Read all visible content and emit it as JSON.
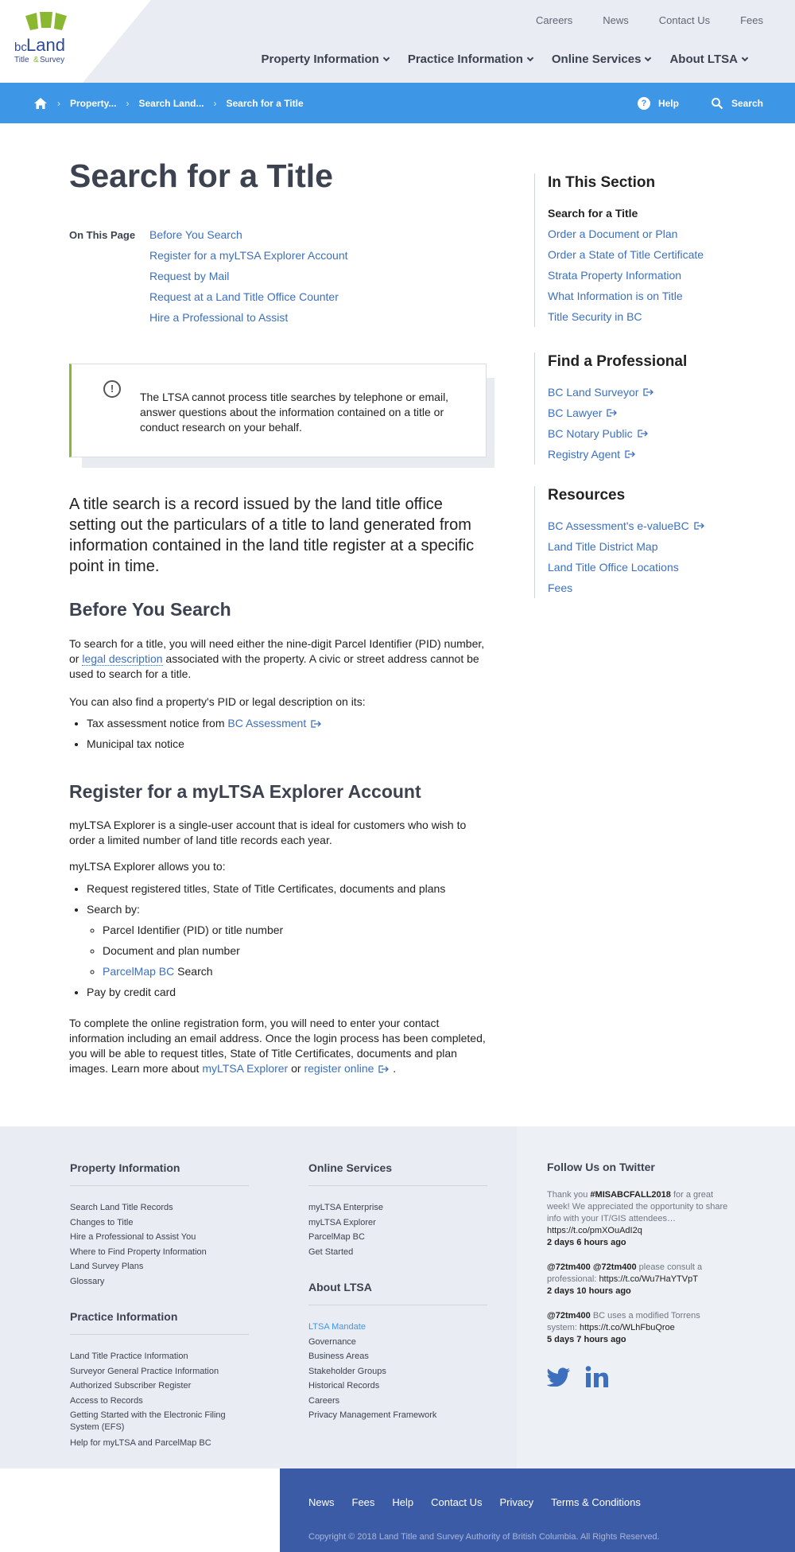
{
  "header": {
    "logo": {
      "bc": "bc",
      "land": "Land",
      "line2_a": "Title",
      "amp": "&",
      "line2_b": "Survey"
    },
    "util_nav": [
      "Careers",
      "News",
      "Contact Us",
      "Fees"
    ],
    "main_nav": [
      "Property Information",
      "Practice Information",
      "Online Services",
      "About LTSA"
    ]
  },
  "breadcrumb": {
    "items": [
      "Property...",
      "Search Land...",
      "Search for a Title"
    ],
    "help_label": "Help",
    "search_label": "Search"
  },
  "main": {
    "title": "Search for a Title",
    "on_this_page_label": "On This Page",
    "on_this_page": [
      "Before You Search",
      "Register for a myLTSA Explorer Account",
      "Request by Mail",
      "Request at a Land Title Office Counter",
      "Hire a Professional to Assist"
    ],
    "callout": "The LTSA cannot process title searches by telephone or email, answer questions about the information contained on a title or conduct research on your behalf.",
    "lead": "A title search is a record issued by the land title office setting out the particulars of a title to land generated from information contained in the land title register at a specific point in time.",
    "before": {
      "heading": "Before You Search",
      "p1_a": "To search for a title, you will need either the nine-digit Parcel Identifier (PID) number, or ",
      "p1_link": "legal description",
      "p1_b": " associated with the property. A civic or street address cannot be used to search for a title.",
      "p2": "You can also find a property's PID or legal description on its:",
      "bullet1_a": "Tax assessment notice from ",
      "bullet1_link": "BC Assessment",
      "bullet2": "Municipal tax notice"
    },
    "register": {
      "heading": "Register for a myLTSA Explorer Account",
      "p1": "myLTSA Explorer is a single-user account that is ideal for customers who wish to order a limited number of land title records each year.",
      "p2": "myLTSA Explorer allows you to:",
      "b1": "Request registered titles, State of Title Certificates, documents and plans",
      "b2": "Search by:",
      "sub1": "Parcel Identifier (PID) or title number",
      "sub2": "Document and plan number",
      "sub3_link": "ParcelMap BC",
      "sub3_rest": " Search",
      "b3": "Pay by credit card",
      "p3_a": "To complete the online registration form, you will need to enter your contact information including an email address. Once the login process has been completed, you will be able to request titles, State of Title Certificates, documents and plan images. Learn more about ",
      "p3_link1": "myLTSA Explorer",
      "p3_mid": " or ",
      "p3_link2": "register online",
      "p3_end": " ."
    }
  },
  "sidebar": {
    "in_this_section": {
      "heading": "In This Section",
      "items": [
        "Search for a Title",
        "Order a Document or Plan",
        "Order a State of Title Certificate",
        "Strata Property Information",
        "What Information is on Title",
        "Title Security in BC"
      ]
    },
    "find_pro": {
      "heading": "Find a Professional",
      "items": [
        "BC Land Surveyor",
        "BC Lawyer",
        "BC Notary Public",
        "Registry Agent"
      ]
    },
    "resources": {
      "heading": "Resources",
      "items": [
        "BC Assessment's e-valueBC",
        "Land Title District Map",
        "Land Title Office Locations",
        "Fees"
      ]
    }
  },
  "footer": {
    "property": {
      "heading": "Property Information",
      "items": [
        "Search Land Title Records",
        "Changes to Title",
        "Hire a Professional to Assist You",
        "Where to Find Property Information",
        "Land Survey Plans",
        "Glossary"
      ]
    },
    "practice": {
      "heading": "Practice Information",
      "items": [
        "Land Title Practice Information",
        "Surveyor General Practice Information",
        "Authorized Subscriber Register",
        "Access to Records",
        "Getting Started with the Electronic Filing System (EFS)",
        "Help for myLTSA and ParcelMap BC"
      ]
    },
    "online": {
      "heading": "Online Services",
      "items": [
        "myLTSA Enterprise",
        "myLTSA Explorer",
        "ParcelMap BC",
        "Get Started"
      ]
    },
    "about": {
      "heading": "About LTSA",
      "items": [
        "LTSA Mandate",
        "Governance",
        "Business Areas",
        "Stakeholder Groups",
        "Historical Records",
        "Careers",
        "Privacy Management Framework"
      ]
    },
    "twitter": {
      "heading": "Follow Us on Twitter",
      "tweets": [
        {
          "pre": "Thank you ",
          "tag": "#MISABCFALL2018",
          "text": " for a great week! We appreciated the opportunity to share info with your IT/GIS attendees…",
          "link": "https://t.co/pmXOuAdI2q",
          "time": "2 days 6 hours ago"
        },
        {
          "pre": "",
          "tag": "@72tm400 @72tm400",
          "text": " please consult a professional: ",
          "link": "https://t.co/Wu7HaYTVpT",
          "time": "2 days 10 hours ago"
        },
        {
          "pre": "",
          "tag": "@72tm400",
          "text": " BC uses a modified Torrens system: ",
          "link": "https://t.co/WLhFbuQroe",
          "time": "5 days 7 hours ago"
        }
      ]
    },
    "bottom_links": [
      "News",
      "Fees",
      "Help",
      "Contact Us",
      "Privacy",
      "Terms & Conditions"
    ],
    "copyright": "Copyright © 2018 Land Title and Survey Authority of British Columbia. All Rights Reserved."
  },
  "colors": {
    "accent_blue": "#3d97e6",
    "link": "#3c6fbd",
    "green": "#8ab830",
    "footer_bar": "#3c5ba7"
  },
  "icons": [
    "home-icon",
    "help-icon",
    "search-icon",
    "alert-icon",
    "external-link-icon",
    "twitter-icon",
    "linkedin-icon"
  ]
}
